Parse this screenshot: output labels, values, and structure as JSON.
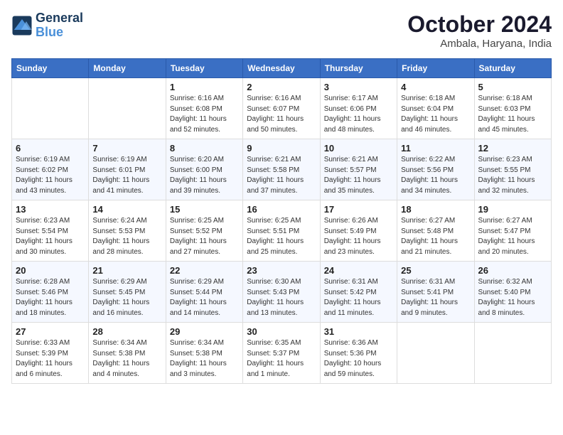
{
  "logo": {
    "line1": "General",
    "line2": "Blue"
  },
  "title": "October 2024",
  "location": "Ambala, Haryana, India",
  "weekdays": [
    "Sunday",
    "Monday",
    "Tuesday",
    "Wednesday",
    "Thursday",
    "Friday",
    "Saturday"
  ],
  "weeks": [
    [
      {
        "day": "",
        "info": ""
      },
      {
        "day": "",
        "info": ""
      },
      {
        "day": "1",
        "info": "Sunrise: 6:16 AM\nSunset: 6:08 PM\nDaylight: 11 hours and 52 minutes."
      },
      {
        "day": "2",
        "info": "Sunrise: 6:16 AM\nSunset: 6:07 PM\nDaylight: 11 hours and 50 minutes."
      },
      {
        "day": "3",
        "info": "Sunrise: 6:17 AM\nSunset: 6:06 PM\nDaylight: 11 hours and 48 minutes."
      },
      {
        "day": "4",
        "info": "Sunrise: 6:18 AM\nSunset: 6:04 PM\nDaylight: 11 hours and 46 minutes."
      },
      {
        "day": "5",
        "info": "Sunrise: 6:18 AM\nSunset: 6:03 PM\nDaylight: 11 hours and 45 minutes."
      }
    ],
    [
      {
        "day": "6",
        "info": "Sunrise: 6:19 AM\nSunset: 6:02 PM\nDaylight: 11 hours and 43 minutes."
      },
      {
        "day": "7",
        "info": "Sunrise: 6:19 AM\nSunset: 6:01 PM\nDaylight: 11 hours and 41 minutes."
      },
      {
        "day": "8",
        "info": "Sunrise: 6:20 AM\nSunset: 6:00 PM\nDaylight: 11 hours and 39 minutes."
      },
      {
        "day": "9",
        "info": "Sunrise: 6:21 AM\nSunset: 5:58 PM\nDaylight: 11 hours and 37 minutes."
      },
      {
        "day": "10",
        "info": "Sunrise: 6:21 AM\nSunset: 5:57 PM\nDaylight: 11 hours and 35 minutes."
      },
      {
        "day": "11",
        "info": "Sunrise: 6:22 AM\nSunset: 5:56 PM\nDaylight: 11 hours and 34 minutes."
      },
      {
        "day": "12",
        "info": "Sunrise: 6:23 AM\nSunset: 5:55 PM\nDaylight: 11 hours and 32 minutes."
      }
    ],
    [
      {
        "day": "13",
        "info": "Sunrise: 6:23 AM\nSunset: 5:54 PM\nDaylight: 11 hours and 30 minutes."
      },
      {
        "day": "14",
        "info": "Sunrise: 6:24 AM\nSunset: 5:53 PM\nDaylight: 11 hours and 28 minutes."
      },
      {
        "day": "15",
        "info": "Sunrise: 6:25 AM\nSunset: 5:52 PM\nDaylight: 11 hours and 27 minutes."
      },
      {
        "day": "16",
        "info": "Sunrise: 6:25 AM\nSunset: 5:51 PM\nDaylight: 11 hours and 25 minutes."
      },
      {
        "day": "17",
        "info": "Sunrise: 6:26 AM\nSunset: 5:49 PM\nDaylight: 11 hours and 23 minutes."
      },
      {
        "day": "18",
        "info": "Sunrise: 6:27 AM\nSunset: 5:48 PM\nDaylight: 11 hours and 21 minutes."
      },
      {
        "day": "19",
        "info": "Sunrise: 6:27 AM\nSunset: 5:47 PM\nDaylight: 11 hours and 20 minutes."
      }
    ],
    [
      {
        "day": "20",
        "info": "Sunrise: 6:28 AM\nSunset: 5:46 PM\nDaylight: 11 hours and 18 minutes."
      },
      {
        "day": "21",
        "info": "Sunrise: 6:29 AM\nSunset: 5:45 PM\nDaylight: 11 hours and 16 minutes."
      },
      {
        "day": "22",
        "info": "Sunrise: 6:29 AM\nSunset: 5:44 PM\nDaylight: 11 hours and 14 minutes."
      },
      {
        "day": "23",
        "info": "Sunrise: 6:30 AM\nSunset: 5:43 PM\nDaylight: 11 hours and 13 minutes."
      },
      {
        "day": "24",
        "info": "Sunrise: 6:31 AM\nSunset: 5:42 PM\nDaylight: 11 hours and 11 minutes."
      },
      {
        "day": "25",
        "info": "Sunrise: 6:31 AM\nSunset: 5:41 PM\nDaylight: 11 hours and 9 minutes."
      },
      {
        "day": "26",
        "info": "Sunrise: 6:32 AM\nSunset: 5:40 PM\nDaylight: 11 hours and 8 minutes."
      }
    ],
    [
      {
        "day": "27",
        "info": "Sunrise: 6:33 AM\nSunset: 5:39 PM\nDaylight: 11 hours and 6 minutes."
      },
      {
        "day": "28",
        "info": "Sunrise: 6:34 AM\nSunset: 5:38 PM\nDaylight: 11 hours and 4 minutes."
      },
      {
        "day": "29",
        "info": "Sunrise: 6:34 AM\nSunset: 5:38 PM\nDaylight: 11 hours and 3 minutes."
      },
      {
        "day": "30",
        "info": "Sunrise: 6:35 AM\nSunset: 5:37 PM\nDaylight: 11 hours and 1 minute."
      },
      {
        "day": "31",
        "info": "Sunrise: 6:36 AM\nSunset: 5:36 PM\nDaylight: 10 hours and 59 minutes."
      },
      {
        "day": "",
        "info": ""
      },
      {
        "day": "",
        "info": ""
      }
    ]
  ]
}
